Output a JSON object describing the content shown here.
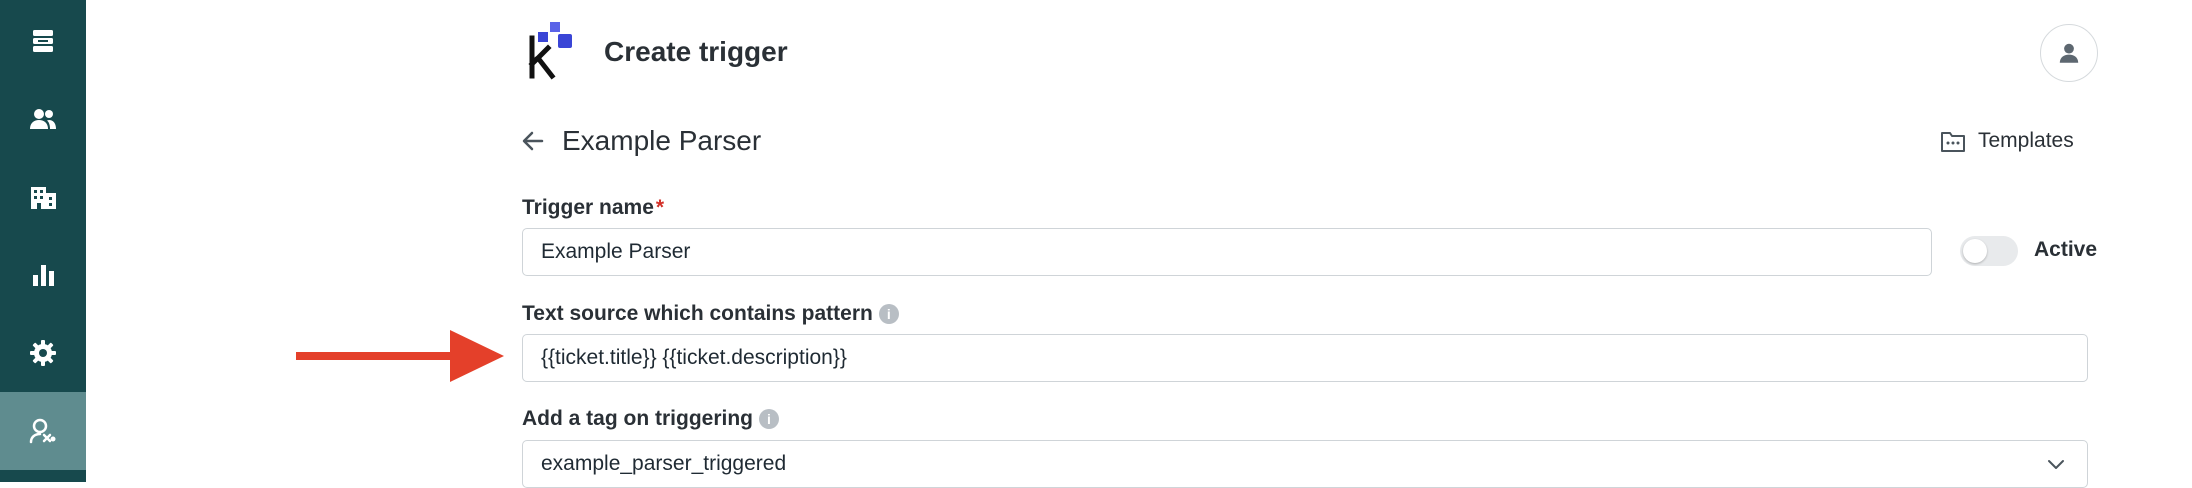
{
  "header": {
    "title": "Create trigger"
  },
  "form": {
    "subtitle": "Example Parser",
    "templates_label": "Templates",
    "trigger_name_label": "Trigger name",
    "required_mark": "*",
    "trigger_name_value": "Example Parser",
    "active_label": "Active",
    "active": false,
    "text_source_label": "Text source which contains pattern",
    "text_source_value": "{{ticket.title}} {{ticket.description}}",
    "tag_label": "Add a tag on triggering",
    "tag_value": "example_parser_triggered"
  },
  "sidebar": {
    "items": [
      {
        "icon": "inbox-icon",
        "active": false
      },
      {
        "icon": "users-icon",
        "active": false
      },
      {
        "icon": "building-icon",
        "active": false
      },
      {
        "icon": "chart-icon",
        "active": false
      },
      {
        "icon": "gear-icon",
        "active": false
      },
      {
        "icon": "triggers-icon",
        "active": true
      }
    ]
  },
  "colors": {
    "sidebar": "#17494d",
    "sidebar_active": "#5f8c8f",
    "accent": "#3a45d6",
    "annotation_arrow": "#e4402a"
  }
}
